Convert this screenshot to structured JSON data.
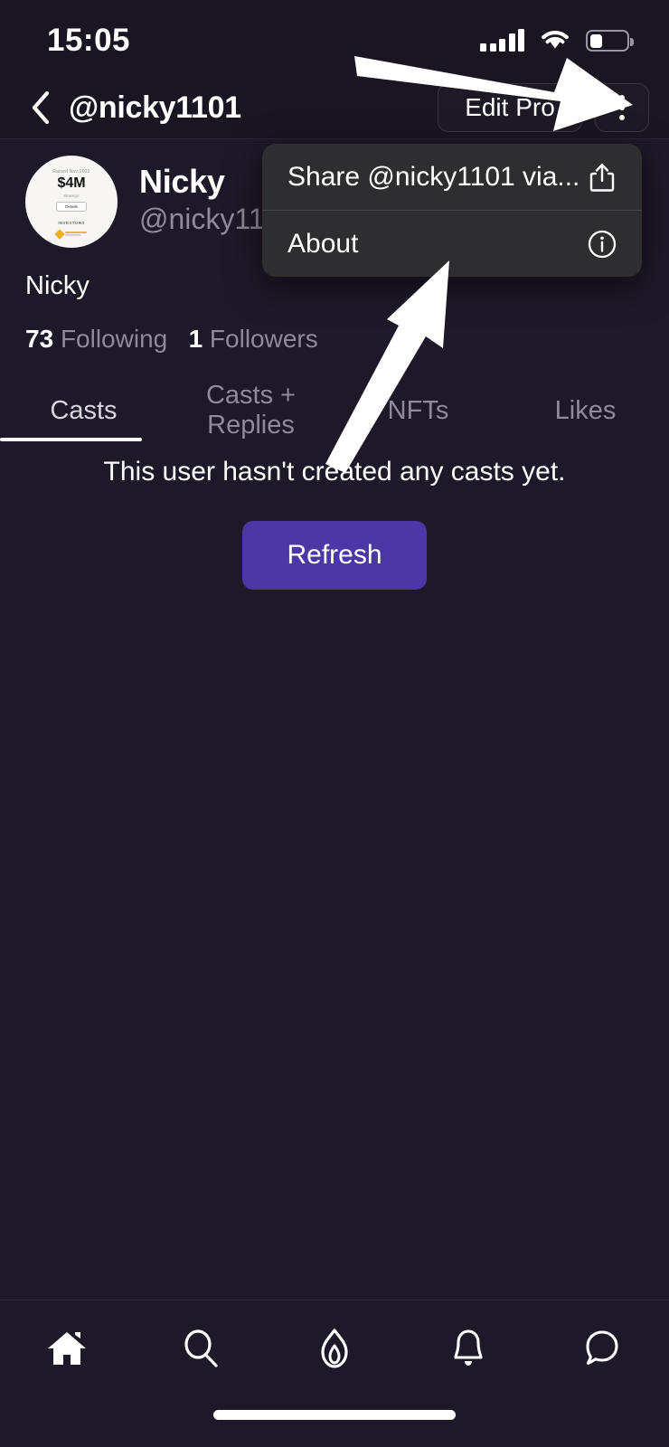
{
  "status_bar": {
    "time": "15:05",
    "signal_icon": "cellular-signal-icon",
    "wifi_icon": "wifi-icon",
    "battery_icon": "battery-low-icon",
    "battery_level_pct": 35
  },
  "header": {
    "back_icon": "back-chevron-icon",
    "title": "@nicky1101",
    "edit_profile_label": "Edit Pro",
    "edit_profile_full_label": "Edit Profile",
    "kebab_icon": "more-vertical-icon"
  },
  "profile": {
    "avatar": {
      "icon": "profile-avatar-image",
      "caption": "Raised Nov 2022",
      "amount": "$4M",
      "subtitle": "Strategic",
      "button_label": "Details",
      "section_label": "INVESTORS",
      "logo_label": "BINANCE"
    },
    "display_name": "Nicky",
    "handle": "@nicky1101",
    "bio": "Nicky",
    "following_count": "73",
    "following_label": "Following",
    "followers_count": "1",
    "followers_label": "Followers"
  },
  "tabs": {
    "items": [
      {
        "label": "Casts",
        "active": true
      },
      {
        "label": "Casts + Replies",
        "active": false
      },
      {
        "label": "NFTs",
        "active": false
      },
      {
        "label": "Likes",
        "active": false
      }
    ]
  },
  "empty_state": {
    "message": "This user hasn't created any casts yet.",
    "refresh_label": "Refresh"
  },
  "dropdown_menu": {
    "items": [
      {
        "label": "Share @nicky1101 via...",
        "icon": "share-icon"
      },
      {
        "label": "About",
        "icon": "info-circle-icon"
      }
    ]
  },
  "bottom_nav": {
    "items": [
      {
        "icon": "home-icon",
        "active": true
      },
      {
        "icon": "search-icon",
        "active": false
      },
      {
        "icon": "flame-icon",
        "active": false
      },
      {
        "icon": "bell-icon",
        "active": false
      },
      {
        "icon": "chat-bubble-icon",
        "active": false
      }
    ]
  },
  "annotations": [
    {
      "name": "arrow-to-more-menu",
      "points_to": "kebab-menu-button"
    },
    {
      "name": "arrow-to-about-item",
      "points_to": "menu-item-about"
    }
  ],
  "colors": {
    "background": "#1e1828",
    "chrome": "#1b1522",
    "menu_background": "#2e2e31",
    "accent": "#4b37a5",
    "muted_text": "#8e8a98",
    "text": "#ffffff"
  }
}
